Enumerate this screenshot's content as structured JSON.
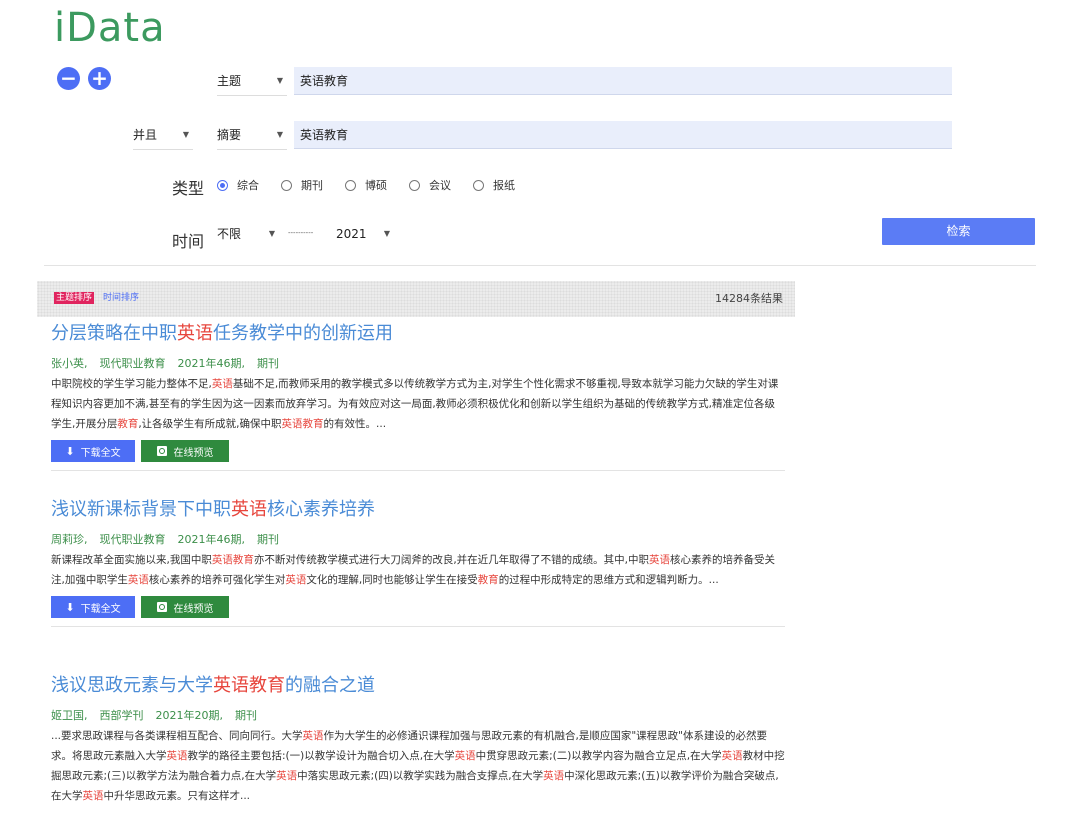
{
  "logo": "iData",
  "query": {
    "row1": {
      "field": "主题",
      "value": "英语教育"
    },
    "row2": {
      "operator": "并且",
      "field": "摘要",
      "value": "英语教育"
    },
    "type_label": "类型",
    "types": [
      "综合",
      "期刊",
      "博硕",
      "会议",
      "报纸"
    ],
    "selected_type": "综合",
    "time_label": "时间",
    "time_from": "不限",
    "time_sep": "----------",
    "time_to": "2021",
    "search_label": "检索"
  },
  "results": {
    "sort_subject": "主题排序",
    "sort_time": "时间排序",
    "count": "14284条结果",
    "download_label": "下载全文",
    "preview_label": "在线预览",
    "items": [
      {
        "title": [
          {
            "t": "分层策略在中职"
          },
          {
            "t": "英语",
            "hl": true
          },
          {
            "t": "任务教学中的创新运用"
          }
        ],
        "author": "张小英,",
        "journal": "现代职业教育",
        "issue": "2021年46期,",
        "kind": "期刊",
        "abstract": [
          {
            "t": "中职院校的学生学习能力整体不足,"
          },
          {
            "t": "英语",
            "hl": true
          },
          {
            "t": "基础不足,而教师采用的教学模式多以传统教学方式为主,对学生个性化需求不够重视,导致本就学习能力欠缺的学生对课程知识内容更加不满,甚至有的学生因为这一因素而放弃学习。为有效应对这一局面,教师必须积极优化和创新以学生组织为基础的传统教学方式,精准定位各级学生,开展分层"
          },
          {
            "t": "教育",
            "hl": true
          },
          {
            "t": ",让各级学生有所成就,确保中职"
          },
          {
            "t": "英语教育",
            "hl": true
          },
          {
            "t": "的有效性。..."
          }
        ]
      },
      {
        "title": [
          {
            "t": "浅议新课标背景下中职"
          },
          {
            "t": "英语",
            "hl": true
          },
          {
            "t": "核心素养培养"
          }
        ],
        "author": "周莉珍,",
        "journal": "现代职业教育",
        "issue": "2021年46期,",
        "kind": "期刊",
        "abstract": [
          {
            "t": "新课程改革全面实施以来,我国中职"
          },
          {
            "t": "英语教育",
            "hl": true
          },
          {
            "t": "亦不断对传统教学模式进行大刀阔斧的改良,并在近几年取得了不错的成绩。其中,中职"
          },
          {
            "t": "英语",
            "hl": true
          },
          {
            "t": "核心素养的培养备受关注,加强中职学生"
          },
          {
            "t": "英语",
            "hl": true
          },
          {
            "t": "核心素养的培养可强化学生对"
          },
          {
            "t": "英语",
            "hl": true
          },
          {
            "t": "文化的理解,同时也能够让学生在接受"
          },
          {
            "t": "教育",
            "hl": true
          },
          {
            "t": "的过程中形成特定的思维方式和逻辑判断力。..."
          }
        ]
      },
      {
        "title": [
          {
            "t": "浅议思政元素与大学"
          },
          {
            "t": "英语教育",
            "hl": true
          },
          {
            "t": "的融合之道"
          }
        ],
        "author": "姬卫国,",
        "journal": "西部学刊",
        "issue": "2021年20期,",
        "kind": "期刊",
        "abstract": [
          {
            "t": "...要求思政课程与各类课程相互配合、同向同行。大学"
          },
          {
            "t": "英语",
            "hl": true
          },
          {
            "t": "作为大学生的必修通识课程加强与思政元素的有机融合,是顺应国家\"课程思政\"体系建设的必然要求。将思政元素融入大学"
          },
          {
            "t": "英语",
            "hl": true
          },
          {
            "t": "教学的路径主要包括:(一)以教学设计为融合切入点,在大学"
          },
          {
            "t": "英语",
            "hl": true
          },
          {
            "t": "中贯穿思政元素;(二)以教学内容为融合立足点,在大学"
          },
          {
            "t": "英语",
            "hl": true
          },
          {
            "t": "教材中挖掘思政元素;(三)以教学方法为融合着力点,在大学"
          },
          {
            "t": "英语",
            "hl": true
          },
          {
            "t": "中落实思政元素;(四)以教学实践为融合支撑点,在大学"
          },
          {
            "t": "英语",
            "hl": true
          },
          {
            "t": "中深化思政元素;(五)以教学评价为融合突破点,在大学"
          },
          {
            "t": "英语",
            "hl": true
          },
          {
            "t": "中升华思政元素。只有这样才..."
          }
        ]
      }
    ]
  }
}
